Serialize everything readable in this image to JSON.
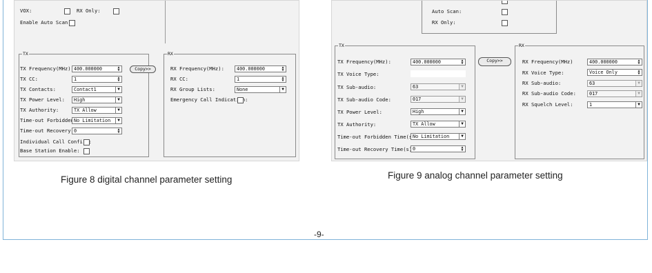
{
  "fig8": {
    "top_vox": "VOX:",
    "top_rx_only": "RX Only:",
    "top_auto_scan": "Enable Auto Scan:",
    "tx_group": "TX",
    "rx_group": "RX",
    "copy_button": "Copy>>",
    "tx": {
      "freq_label": "TX Frequency(MHz):",
      "freq_value": "400.000000",
      "cc_label": "TX CC:",
      "cc_value": "1",
      "contacts_label": "TX Contacts:",
      "contacts_value": "Contact1",
      "power_label": "TX Power Level:",
      "power_value": "High",
      "authority_label": "TX Authority:",
      "authority_value": "TX Allow",
      "tof_label": "Time-out Forbidden(s):",
      "tof_value": "No Limitation",
      "tor_label": "Time-out Recovery(s):",
      "tor_value": "0",
      "ind_label": "Individual Call Confirm:",
      "base_label": "Base Station Enable:"
    },
    "rx": {
      "freq_label": "RX Frequency(MHz):",
      "freq_value": "400.000000",
      "cc_label": "RX CC:",
      "cc_value": "1",
      "group_label": "RX Group Lists:",
      "group_value": "None",
      "emg_label": "Emergency Call Indication:"
    },
    "caption": "Figure 8 digital channel parameter setting"
  },
  "fig9": {
    "top_auto_scan": "Auto Scan:",
    "top_rx_only": "RX Only:",
    "tx_group": "TX",
    "rx_group": "RX",
    "copy_button": "Copy>>",
    "tx": {
      "freq_label": "TX Frequency(MHz):",
      "freq_value": "400.000000",
      "voice_label": "TX Voice Type:",
      "sub_label": "TX Sub-audio:",
      "sub_value": "63",
      "subcode_label": "TX Sub-audio Code:",
      "subcode_value": "017",
      "power_label": "TX Power Level:",
      "power_value": "High",
      "authority_label": "TX Authority:",
      "authority_value": "TX Allow",
      "tof_label": "Time-out Forbidden Time(s):",
      "tof_value": "No Limitation",
      "tor_label": "Time-out Recovery Time(s):",
      "tor_value": "0"
    },
    "rx": {
      "freq_label": "RX Frequency(MHz)",
      "freq_value": "400.000000",
      "voice_label": "RX Voice Type:",
      "voice_value": "Voice Only",
      "sub_label": "RX Sub-audio:",
      "sub_value": "63",
      "subcode_label": "RX Sub-audio Code:",
      "subcode_value": "017",
      "squelch_label": "RX Squelch Level:",
      "squelch_value": "1"
    },
    "caption": "Figure 9 analog channel parameter setting"
  },
  "page_number": "-9-",
  "icons": {
    "dropdown": "chevron-down-icon",
    "spinner": "spin-arrows-icon"
  }
}
